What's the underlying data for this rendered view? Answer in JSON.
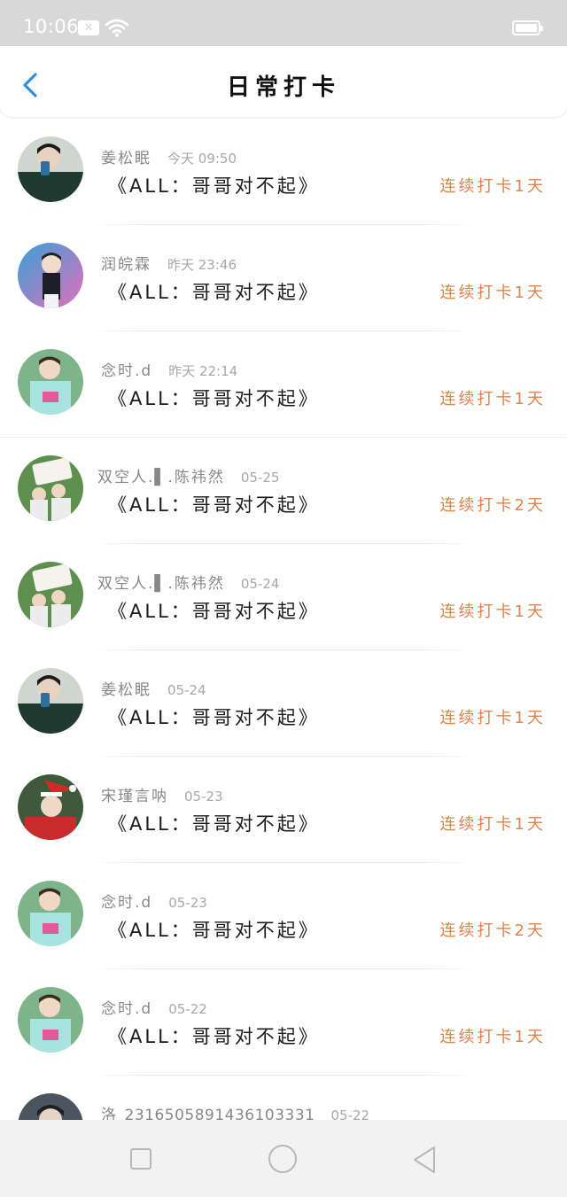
{
  "status_bar": {
    "time": "10:06",
    "notification_glyph": "✕"
  },
  "header": {
    "title": "日常打卡",
    "back_icon": "chevron-left-icon"
  },
  "colors": {
    "accent": "#2f8fe0",
    "streak": "#e3824a",
    "name": "#888888",
    "time": "#a8a8a8"
  },
  "checkins": [
    {
      "user": "姜松眠",
      "time": "今天 09:50",
      "title": "《ALL：哥哥对不起》",
      "streak": "连续打卡1天"
    },
    {
      "user": "润皖霖",
      "time": "昨天 23:46",
      "title": "《ALL：哥哥对不起》",
      "streak": "连续打卡1天"
    },
    {
      "user": "念时.d",
      "time": "昨天 22:14",
      "title": "《ALL：哥哥对不起》",
      "streak": "连续打卡1天"
    },
    {
      "user": "双空人.▌.陈祎然",
      "time": "05-25",
      "title": "《ALL：哥哥对不起》",
      "streak": "连续打卡2天"
    },
    {
      "user": "双空人.▌.陈祎然",
      "time": "05-24",
      "title": "《ALL：哥哥对不起》",
      "streak": "连续打卡1天"
    },
    {
      "user": "姜松眠",
      "time": "05-24",
      "title": "《ALL：哥哥对不起》",
      "streak": "连续打卡1天"
    },
    {
      "user": "宋瑾言呐",
      "time": "05-23",
      "title": "《ALL：哥哥对不起》",
      "streak": "连续打卡1天"
    },
    {
      "user": "念时.d",
      "time": "05-23",
      "title": "《ALL：哥哥对不起》",
      "streak": "连续打卡2天"
    },
    {
      "user": "念时.d",
      "time": "05-22",
      "title": "《ALL：哥哥对不起》",
      "streak": "连续打卡1天"
    },
    {
      "user": "洛_2316505891436103331",
      "time": "05-22",
      "title": "",
      "streak": ""
    }
  ],
  "nav_bar": {
    "recent_icon": "square-icon",
    "home_icon": "circle-icon",
    "back_icon": "triangle-back-icon"
  }
}
